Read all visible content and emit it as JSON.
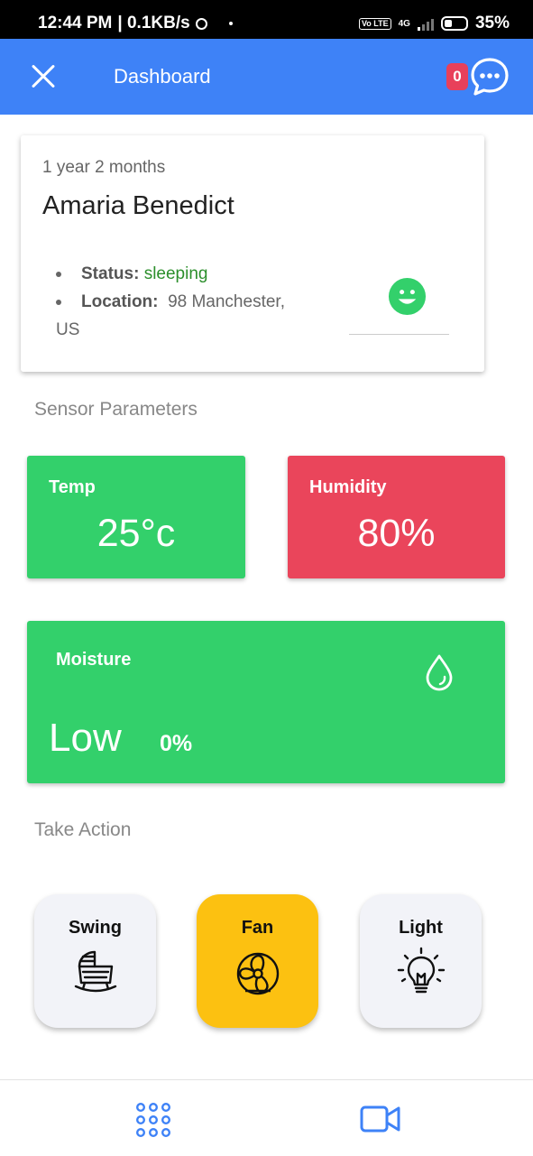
{
  "status_bar": {
    "time": "12:44 PM",
    "speed": "| 0.1KB/s",
    "network": "4G",
    "volte": "Vo LTE",
    "battery": "35%"
  },
  "app_bar": {
    "title": "Dashboard",
    "notification_count": "0",
    "icons": [
      "close-icon",
      "chat-icon"
    ]
  },
  "profile": {
    "age": "1 year 2 months",
    "name": "Amaria Benedict",
    "status_label": "Status:",
    "status_value": "sleeping",
    "location_label": "Location:",
    "location_value_line1": "98 Manchester,",
    "location_value_line2": "US",
    "mood_icon": "smiley-icon",
    "status_color": "#2c8f2c"
  },
  "sensors": {
    "section_title": "Sensor Parameters",
    "temp": {
      "label": "Temp",
      "value": "25°c",
      "color": "#33d06b"
    },
    "humidity": {
      "label": "Humidity",
      "value": "80%",
      "color": "#ea455b"
    },
    "moisture": {
      "label": "Moisture",
      "level": "Low",
      "percent": "0%",
      "icon": "water-drop-icon",
      "color": "#33d06b"
    }
  },
  "actions": {
    "section_title": "Take Action",
    "items": [
      {
        "label": "Swing",
        "icon": "cradle-icon",
        "active": false
      },
      {
        "label": "Fan",
        "icon": "fan-icon",
        "active": true,
        "active_color": "#fcc111"
      },
      {
        "label": "Light",
        "icon": "light-bulb-icon",
        "active": false
      }
    ]
  },
  "bottom_nav": {
    "items": [
      {
        "icon": "grid-icon"
      },
      {
        "icon": "video-camera-icon"
      }
    ],
    "accent": "#3e82f7"
  }
}
